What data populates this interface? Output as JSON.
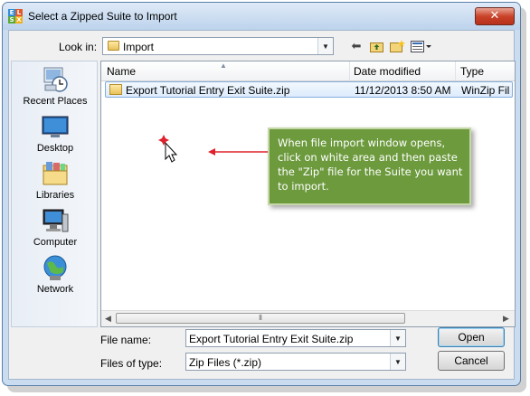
{
  "window": {
    "title": "Select a Zipped Suite to Import",
    "close_glyph": "✕"
  },
  "toolbar": {
    "look_in_label": "Look in:",
    "look_in_value": "Import"
  },
  "places": [
    {
      "label": "Recent Places",
      "icon": "recent-places-icon"
    },
    {
      "label": "Desktop",
      "icon": "desktop-icon"
    },
    {
      "label": "Libraries",
      "icon": "libraries-icon"
    },
    {
      "label": "Computer",
      "icon": "computer-icon"
    },
    {
      "label": "Network",
      "icon": "network-icon"
    }
  ],
  "file_list": {
    "columns": [
      "Name",
      "Date modified",
      "Type"
    ],
    "rows": [
      {
        "name": "Export Tutorial Entry Exit Suite.zip",
        "date_modified": "11/12/2013 8:50 AM",
        "type": "WinZip Fil"
      }
    ]
  },
  "callout": {
    "text": "When file import window opens,  click on white area and then paste the \"Zip\" file for the Suite you want to import.",
    "color": "#6c9a3d",
    "arrow_color": "#e0202a"
  },
  "form": {
    "file_name_label": "File name:",
    "file_name_value": "Export Tutorial Entry Exit Suite.zip",
    "file_type_label": "Files of type:",
    "file_type_value": "Zip Files (*.zip)",
    "open_label": "Open",
    "cancel_label": "Cancel"
  }
}
